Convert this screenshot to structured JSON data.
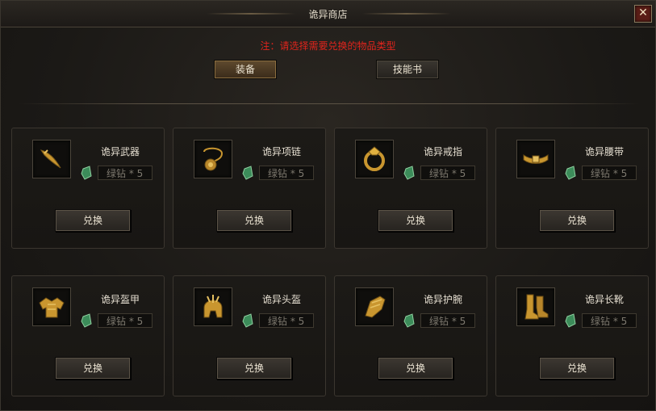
{
  "window": {
    "title": "诡异商店",
    "close_glyph": "✕"
  },
  "note": "注：请选择需要兑换的物品类型",
  "tabs": [
    {
      "label": "装备",
      "active": true
    },
    {
      "label": "技能书",
      "active": false
    }
  ],
  "items": [
    {
      "name": "诡异武器",
      "price": "绿钻 * 5",
      "button": "兑换",
      "icon": "weapon-icon"
    },
    {
      "name": "诡异项链",
      "price": "绿钻 * 5",
      "button": "兑换",
      "icon": "necklace-icon"
    },
    {
      "name": "诡异戒指",
      "price": "绿钻 * 5",
      "button": "兑换",
      "icon": "ring-icon"
    },
    {
      "name": "诡异腰带",
      "price": "绿钻 * 5",
      "button": "兑换",
      "icon": "belt-icon"
    },
    {
      "name": "诡异盔甲",
      "price": "绿钻 * 5",
      "button": "兑换",
      "icon": "armor-icon"
    },
    {
      "name": "诡异头盔",
      "price": "绿钻 * 5",
      "button": "兑换",
      "icon": "helmet-icon"
    },
    {
      "name": "诡异护腕",
      "price": "绿钻 * 5",
      "button": "兑换",
      "icon": "bracer-icon"
    },
    {
      "name": "诡异长靴",
      "price": "绿钻 * 5",
      "button": "兑换",
      "icon": "boots-icon"
    }
  ],
  "colors": {
    "gold": "#c9962f",
    "note_red": "#e0241c",
    "gem_green": "#3c8c5a"
  }
}
